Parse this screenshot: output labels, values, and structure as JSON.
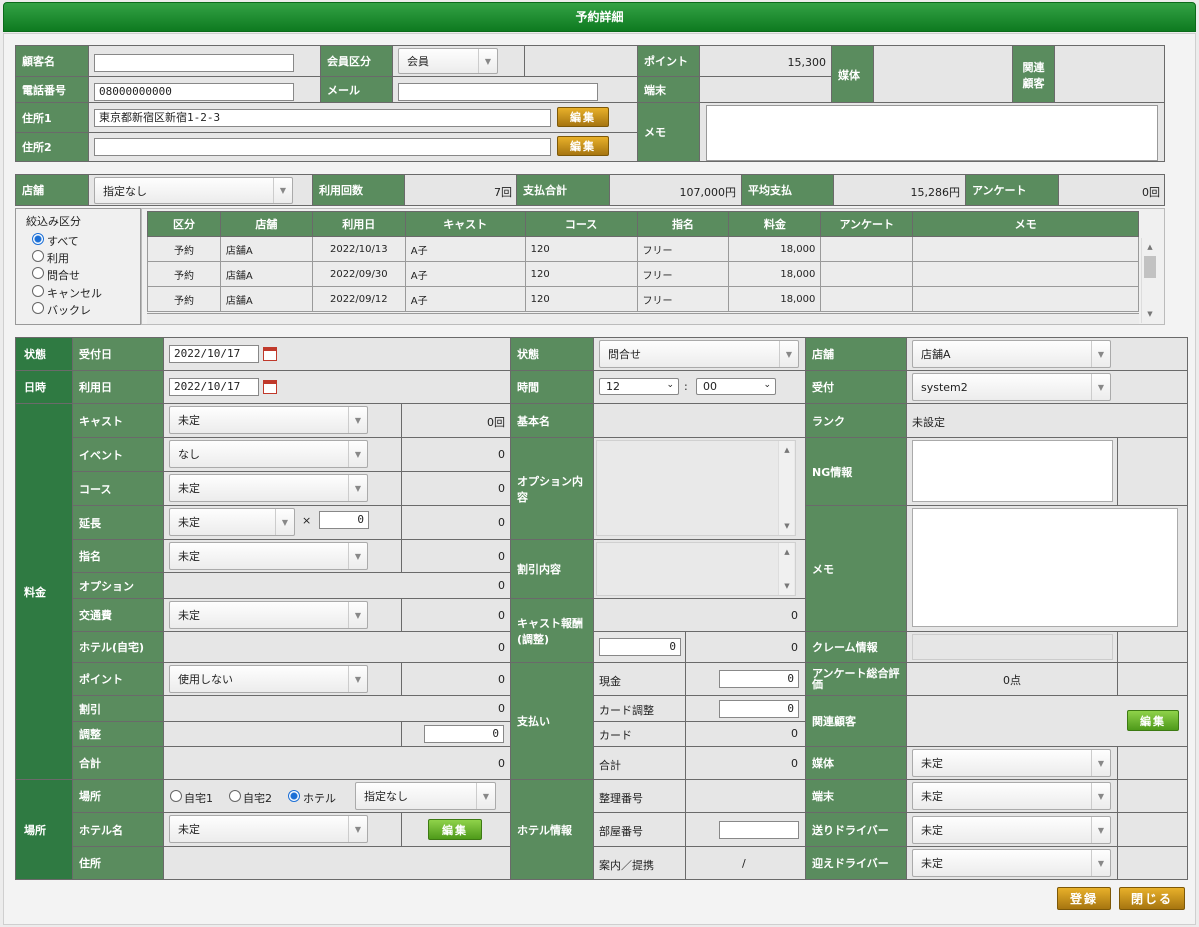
{
  "title": "予約詳細",
  "customer": {
    "name_label": "顧客名",
    "name_value": "",
    "member_label": "会員区分",
    "member_value": "会員",
    "point_label": "ポイント",
    "point_value": "15,300",
    "media_label": "媒体",
    "related_label": "関連顧客",
    "phone_label": "電話番号",
    "phone_value": "08000000000",
    "mail_label": "メール",
    "mail_value": "",
    "terminal_label": "端末",
    "addr1_label": "住所1",
    "addr1_value": "東京都新宿区新宿1-2-3",
    "addr2_label": "住所2",
    "addr2_value": "",
    "edit_label": "編集",
    "memo_label": "メモ"
  },
  "stats": {
    "store_label": "店舗",
    "store_value": "指定なし",
    "usage_label": "利用回数",
    "usage_value": "7回",
    "total_label": "支払合計",
    "total_value": "107,000円",
    "avg_label": "平均支払",
    "avg_value": "15,286円",
    "survey_label": "アンケート",
    "survey_value": "0回"
  },
  "filter": {
    "label": "絞込み区分",
    "options": [
      "すべて",
      "利用",
      "問合せ",
      "キャンセル",
      "バックレ"
    ],
    "selected": 0
  },
  "history": {
    "headers": [
      "区分",
      "店舗",
      "利用日",
      "キャスト",
      "コース",
      "指名",
      "料金",
      "アンケート",
      "メモ"
    ],
    "rows": [
      [
        "予約",
        "店舗A",
        "2022/10/13",
        "A子",
        "120",
        "フリー",
        "18,000",
        "",
        ""
      ],
      [
        "予約",
        "店舗A",
        "2022/09/30",
        "A子",
        "120",
        "フリー",
        "18,000",
        "",
        ""
      ],
      [
        "予約",
        "店舗A",
        "2022/09/12",
        "A子",
        "120",
        "フリー",
        "18,000",
        "",
        ""
      ]
    ]
  },
  "form": {
    "state_label": "状態",
    "received_label": "受付日",
    "received_value": "2022/10/17",
    "datetime_label": "日時",
    "use_label": "利用日",
    "use_value": "2022/10/17",
    "fee_label": "料金",
    "cast_label": "キャスト",
    "cast_value": "未定",
    "cast_count": "0回",
    "event_label": "イベント",
    "event_value": "なし",
    "course_label": "コース",
    "course_value": "未定",
    "ext_label": "延長",
    "ext_value": "未定",
    "ext_times": "×",
    "ext_count": "0",
    "nominate_label": "指名",
    "nominate_value": "未定",
    "option_label": "オプション",
    "transport_label": "交通費",
    "transport_value": "未定",
    "hotel_home_label": "ホテル(自宅)",
    "point_label": "ポイント",
    "point_value": "使用しない",
    "discount_label": "割引",
    "adjust_label": "調整",
    "adjust_value": "0",
    "total_label": "合計",
    "zero": "0",
    "place_group_label": "場所",
    "place_label": "場所",
    "place_opts": [
      "自宅1",
      "自宅2",
      "ホテル"
    ],
    "place_selected": 2,
    "place_select_value": "指定なし",
    "hotel_name_label": "ホテル名",
    "hotel_name_value": "未定",
    "edit_label": "編集",
    "address_label": "住所",
    "state2_label": "状態",
    "state2_value": "問合せ",
    "time_label": "時間",
    "hour_value": "12",
    "colon": ":",
    "min_value": "00",
    "basic_label": "基本名",
    "option_content_label": "オプション内容",
    "discount_content_label": "割引内容",
    "cast_reward_label": "キャスト報酬(調整)",
    "cast_reward_value": "0",
    "pay_label": "支払い",
    "cash_label": "現金",
    "cash_value": "0",
    "card_adj_label": "カード調整",
    "card_adj_value": "0",
    "card_label": "カード",
    "pay_total_label": "合計",
    "hotel_info_label": "ホテル情報",
    "ref_no_label": "整理番号",
    "room_no_label": "部屋番号",
    "guide_label": "案内／提携",
    "guide_value": "/",
    "store_label": "店舗",
    "store_value": "店舗A",
    "reception_label": "受付",
    "reception_value": "system2",
    "rank_label": "ランク",
    "rank_value": "未設定",
    "ng_label": "NG情報",
    "memo_label": "メモ",
    "claim_label": "クレーム情報",
    "survey_eval_label": "アンケート総合評価",
    "survey_eval_value": "0点",
    "related_label": "関連顧客",
    "media_label": "媒体",
    "media_value": "未定",
    "terminal_label": "端末",
    "terminal_value": "未定",
    "send_driver_label": "送りドライバー",
    "send_driver_value": "未定",
    "pick_driver_label": "迎えドライバー",
    "pick_driver_value": "未定"
  },
  "buttons": {
    "register": "登録",
    "close": "閉じる"
  }
}
